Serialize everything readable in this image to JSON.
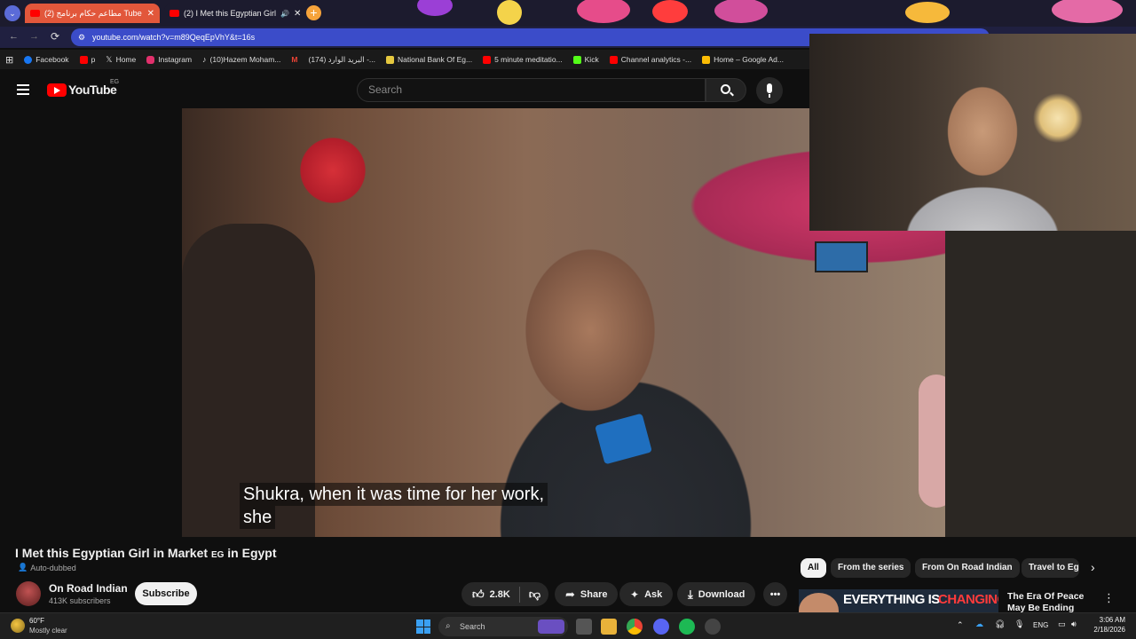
{
  "browser": {
    "tabs": [
      {
        "label": "(2) مطاعم حكام برنامج Tube"
      },
      {
        "label": "(2) I Met this Egyptian Girl"
      }
    ],
    "url": "youtube.com/watch?v=m89QeqEpVhY&t=16s",
    "bookmarks": [
      {
        "label": "Facebook",
        "color": "#1877f2"
      },
      {
        "label": "p",
        "color": "#ff0000"
      },
      {
        "label": "Home",
        "color": "#ffffff"
      },
      {
        "label": "Instagram",
        "color": "#e1306c"
      },
      {
        "label": "(10)Hazem Moham...",
        "color": "#eeeeee"
      },
      {
        "label": "",
        "color": "#ea4335"
      },
      {
        "label": "(174) البريد الوارد -...",
        "color": "#ea4335"
      },
      {
        "label": "National Bank Of Eg...",
        "color": "#e5c83f"
      },
      {
        "label": "5 minute meditatio...",
        "color": "#ff0000"
      },
      {
        "label": "Kick",
        "color": "#53fc18"
      },
      {
        "label": "Channel analytics -...",
        "color": "#ff0000"
      },
      {
        "label": "Home – Google Ad...",
        "color": "#fbbc04"
      }
    ]
  },
  "youtube": {
    "logo_text": "YouTube",
    "region": "EG",
    "search_placeholder": "Search"
  },
  "video": {
    "caption_line1": "Shukra, when it was time for her work,",
    "caption_line2": "she",
    "title": "I Met this Egyptian Girl in Market",
    "title_flag": "EG",
    "title_suffix": "in Egypt",
    "auto_dubbed": "Auto-dubbed",
    "channel_name": "On Road Indian",
    "subscribers": "413K subscribers",
    "subscribe_label": "Subscribe",
    "likes": "2.8K",
    "share_label": "Share",
    "ask_label": "Ask",
    "download_label": "Download"
  },
  "chips": [
    "All",
    "From the series",
    "From On Road Indian",
    "Travel to Eg"
  ],
  "recommendation": {
    "thumb_text_a": "EVERYTHING IS",
    "thumb_text_b": "CHANGING",
    "title": "The Era Of Peace May Be Ending"
  },
  "taskbar": {
    "weather_temp": "60°F",
    "weather_desc": "Mostly clear",
    "search_label": "Search",
    "lang": "ENG",
    "time": "3:06 AM",
    "date": "2/18/2026"
  }
}
